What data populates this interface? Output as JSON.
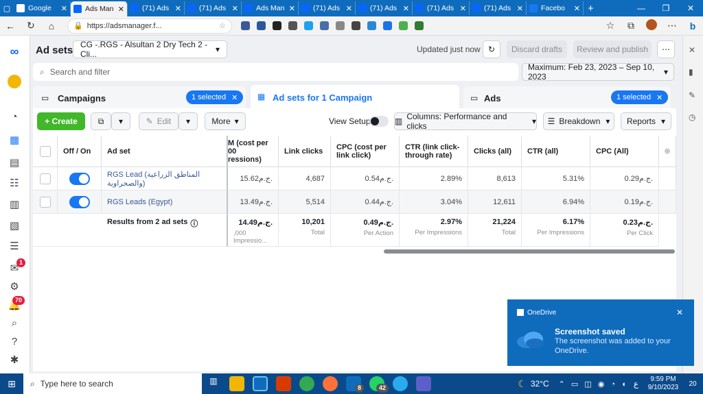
{
  "browser": {
    "tabs": [
      {
        "title": "Google",
        "color": "#ffffff"
      },
      {
        "title": "Ads Man",
        "color": "#0866ff",
        "active": true
      },
      {
        "title": "(71) Ads",
        "color": "#0866ff"
      },
      {
        "title": "(71) Ads",
        "color": "#0866ff"
      },
      {
        "title": "Ads Man",
        "color": "#0866ff"
      },
      {
        "title": "(71) Ads",
        "color": "#0866ff"
      },
      {
        "title": "(71) Ads",
        "color": "#0866ff"
      },
      {
        "title": "(71) Ads",
        "color": "#0866ff"
      },
      {
        "title": "(71) Ads",
        "color": "#0866ff"
      },
      {
        "title": "Facebo",
        "color": "#1877f2"
      }
    ],
    "url": "https://adsmanager.f..."
  },
  "header": {
    "section": "Ad sets",
    "campaign": "CG -.RGS - Alsultan 2 Dry Tech 2 - Cli...",
    "updated": "Updated just now",
    "discard": "Discard drafts",
    "review": "Review and publish",
    "more": "⋯"
  },
  "search": {
    "placeholder": "Search and filter",
    "date": "Maximum: Feb 23, 2023 – Sep 10, 2023"
  },
  "tabs": {
    "campaigns": "Campaigns",
    "campaigns_sel": "1 selected",
    "adsets": "Ad sets for 1 Campaign",
    "ads": "Ads",
    "ads_sel": "1 selected"
  },
  "toolbar": {
    "create": "+ Create",
    "edit": "Edit",
    "more": "More",
    "view_setup": "View Setup",
    "columns": "Columns: Performance and clicks",
    "breakdown": "Breakdown",
    "reports": "Reports"
  },
  "table": {
    "headers": [
      "Off / On",
      "Ad set",
      "M (cost per\n00\nressions)",
      "Link clicks",
      "CPC (cost per link click)",
      "CTR (link click-through rate)",
      "Clicks (all)",
      "CTR (all)",
      "CPC (All)"
    ],
    "rows": [
      {
        "name": "RGS Lead (المناطق الزراعية والصحراوية)",
        "cpm": "15.62ج.م.",
        "link_clicks": "4,687",
        "cpc": "0.54ج.م.",
        "ctr_link": "2.89%",
        "clicks": "8,613",
        "ctr_all": "5.31%",
        "cpc_all": "0.29ج.م."
      },
      {
        "name": "RGS Leads (Egypt)",
        "cpm": "13.49ج.م.",
        "link_clicks": "5,514",
        "cpc": "0.44ج.م.",
        "ctr_link": "3.04%",
        "clicks": "12,611",
        "ctr_all": "6.94%",
        "cpc_all": "0.19ج.م."
      }
    ],
    "summary": {
      "label": "Results from 2 ad sets",
      "cpm": "14.49ج.م.",
      "cpm_sub": ",000 Impressio...",
      "link_clicks": "10,201",
      "link_clicks_sub": "Total",
      "cpc": "0.49ج.م.",
      "cpc_sub": "Per Action",
      "ctr_link": "2.97%",
      "ctr_link_sub": "Per Impressions",
      "clicks": "21,224",
      "clicks_sub": "Total",
      "ctr_all": "6.17%",
      "ctr_all_sub": "Per Impressions",
      "cpc_all": "0.23ج.م.",
      "cpc_all_sub": "Per Click"
    }
  },
  "toast": {
    "app": "OneDrive",
    "title": "Screenshot saved",
    "body": "The screenshot was added to your OneDrive."
  },
  "rail": {
    "notif1": "1",
    "notif2": "70"
  },
  "taskbar": {
    "search": "Type here to search",
    "temp": "32°C",
    "time": "9:59 PM",
    "date": "9/10/2023",
    "lang": "ع",
    "notif": "20",
    "mail_badge": "8",
    "wa_badge": "42"
  },
  "colors": {
    "primary": "#1877f2",
    "create": "#42b72a"
  }
}
